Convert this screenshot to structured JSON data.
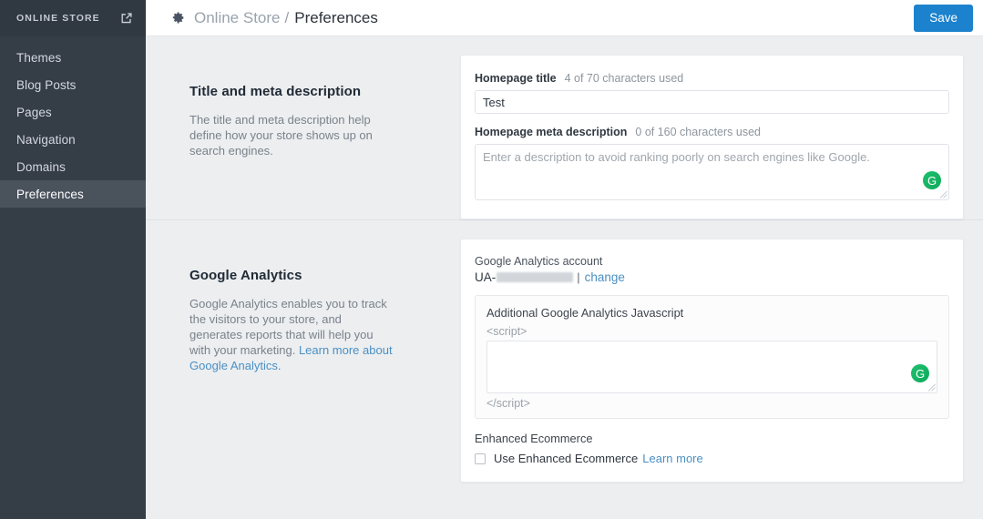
{
  "sidebar": {
    "header_title": "ONLINE STORE",
    "external_link_icon": "external-link-icon",
    "items": [
      {
        "label": "Themes",
        "active": false
      },
      {
        "label": "Blog Posts",
        "active": false
      },
      {
        "label": "Pages",
        "active": false
      },
      {
        "label": "Navigation",
        "active": false
      },
      {
        "label": "Domains",
        "active": false
      },
      {
        "label": "Preferences",
        "active": true
      }
    ]
  },
  "topbar": {
    "gear_icon": "gear-icon",
    "breadcrumb_parent": "Online Store",
    "breadcrumb_separator": "/",
    "breadcrumb_current": "Preferences",
    "save_label": "Save",
    "save_color": "#1c82cd"
  },
  "sections": {
    "seo": {
      "title": "Title and meta description",
      "description": "The title and meta description help define how your store shows up on search engines.",
      "homepage_title_label": "Homepage title",
      "homepage_title_hint": "4 of 70 characters used",
      "homepage_title_value": "Test",
      "meta_label": "Homepage meta description",
      "meta_hint": "0 of 160 characters used",
      "meta_value": "",
      "meta_placeholder": "Enter a description to avoid ranking poorly on search engines like Google.",
      "grammarly_badge": "G"
    },
    "analytics": {
      "title": "Google Analytics",
      "description_text": "Google Analytics enables you to track the visitors to your store, and generates reports that will help you with your marketing. ",
      "description_link": "Learn more about Google Analytics",
      "description_tail": ".",
      "account_label": "Google Analytics account",
      "ua_prefix": "UA-",
      "ua_redacted": "",
      "ua_separator": "|",
      "change_link": "change",
      "js_panel_title": "Additional Google Analytics Javascript",
      "script_open": "<script>",
      "script_value": "",
      "script_close": "</script>",
      "grammarly_badge": "G",
      "enhanced_label": "Enhanced Ecommerce",
      "enhanced_checkbox_label": "Use Enhanced Ecommerce",
      "enhanced_checkbox_checked": false,
      "enhanced_learn_more": "Learn more"
    }
  }
}
